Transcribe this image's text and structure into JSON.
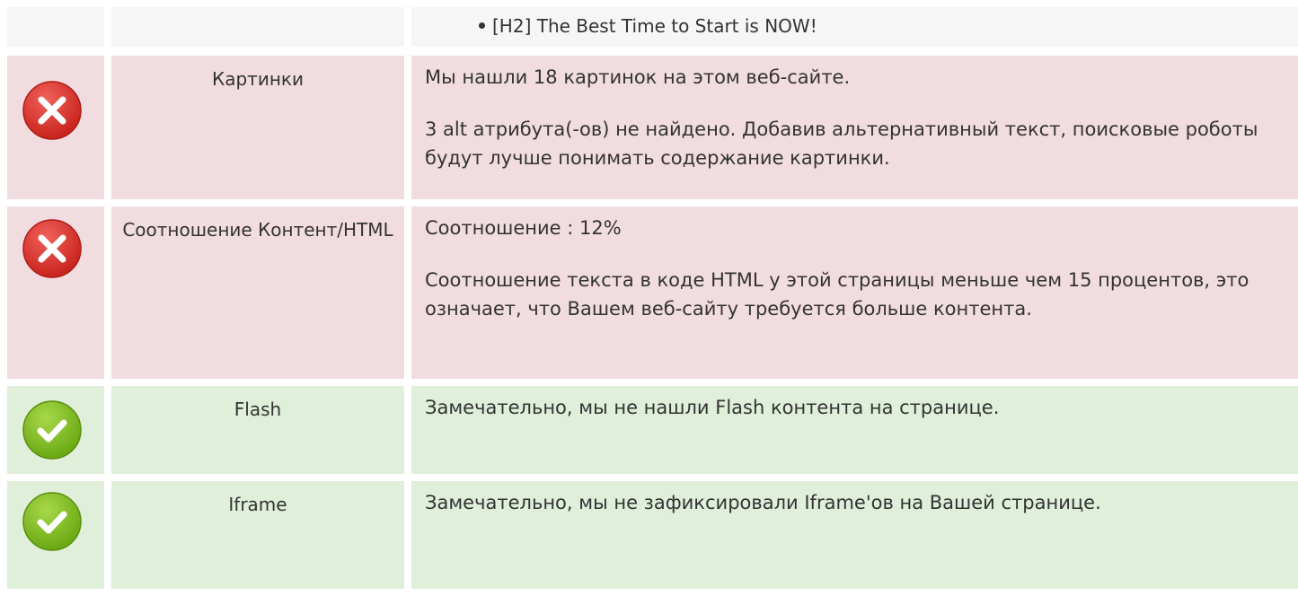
{
  "top_row": {
    "heading_item": "[H2] The Best Time to Start is NOW!"
  },
  "rows": [
    {
      "status": "error",
      "name": "Картинки",
      "paragraphs": [
        "Мы нашли 18 картинок на этом веб-сайте.",
        "3 alt атрибута(-ов) не найдено. Добавив альтернативный текст, поисковые роботы будут лучше понимать содержание картинки."
      ]
    },
    {
      "status": "error",
      "name": "Соотношение Контент/HTML",
      "paragraphs": [
        "Соотношение : 12%",
        "Соотношение текста в коде HTML у этой страницы меньше чем 15 процентов, это означает, что Вашем веб-сайту требуется больше контента."
      ]
    },
    {
      "status": "ok",
      "name": "Flash",
      "paragraphs": [
        "Замечательно, мы не нашли Flash контента на странице."
      ]
    },
    {
      "status": "ok",
      "name": "Iframe",
      "paragraphs": [
        "Замечательно, мы не зафиксировали Iframe'ов на Вашей странице."
      ]
    }
  ],
  "colors": {
    "error_bg": "#f1dde0",
    "ok_bg": "#dfefd9",
    "neutral_bg": "#f6f6f6",
    "error_icon": "#d9302a",
    "ok_icon": "#7cb518"
  },
  "icons": {
    "error": "error-x-icon",
    "ok": "success-check-icon"
  }
}
